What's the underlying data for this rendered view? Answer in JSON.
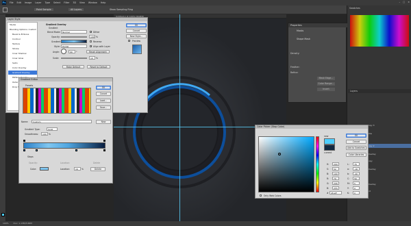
{
  "menubar": {
    "logo": "Ps",
    "items": [
      "File",
      "Edit",
      "Image",
      "Layer",
      "Type",
      "Select",
      "Filter",
      "3D",
      "View",
      "Window",
      "Help"
    ],
    "window_controls": [
      "–",
      "□",
      "×"
    ]
  },
  "options": {
    "show_sampling_ring": "Show Sampling Ring",
    "sample_size": "Point Sample",
    "sample": "All Layers"
  },
  "tabs": [
    "Untitled-1 @ 100% (RGB/8)"
  ],
  "status": {
    "zoom": "100%",
    "doc": "Doc: 1.13M/3.66M"
  },
  "layer_style": {
    "title": "Layer Style",
    "styles_header": "Styles",
    "items": [
      "Blending Options: Custom",
      "Bevel & Emboss",
      "Contour",
      "Texture",
      "Stroke",
      "Inner Shadow",
      "Inner Glow",
      "Satin",
      "Color Overlay",
      "Gradient Overlay",
      "Pattern Overlay",
      "Outer Glow",
      "Drop Shadow"
    ],
    "selected_index": 9,
    "section_title": "Gradient Overlay",
    "section_sub": "Gradient",
    "blend_mode_label": "Blend Mode:",
    "blend_mode": "Normal",
    "dither": "Dither",
    "opacity_label": "Opacity:",
    "opacity": "100",
    "pct": "%",
    "gradient_label": "Gradient:",
    "reverse": "Reverse",
    "style_label": "Style:",
    "style": "Radial",
    "align": "Align with Layer",
    "angle_label": "Angle:",
    "angle": "90",
    "deg": "°",
    "reset_alignment": "Reset Alignment",
    "scale_label": "Scale:",
    "scale": "10",
    "make_default": "Make Default",
    "reset_default": "Reset to Default",
    "ok": "OK",
    "cancel": "Cancel",
    "new_style": "New Style...",
    "preview": "Preview"
  },
  "gradient_editor": {
    "title": "Gradient Editor",
    "presets": "Presets",
    "ok": "OK",
    "cancel": "Cancel",
    "load": "Load...",
    "save": "Save...",
    "name_label": "Name:",
    "name": "Custom",
    "new": "New",
    "type_label": "Gradient Type:",
    "type": "Solid",
    "smooth_label": "Smoothness:",
    "smooth": "100",
    "pct": "%",
    "stops_label": "Stops",
    "opacity_label": "Opacity:",
    "location_label": "Location:",
    "delete": "Delete",
    "color_label": "Color:",
    "location": "16",
    "loc_pct": "%",
    "colors": {
      "left": "#2a7fc8",
      "mid": "#7fc6f0",
      "right": "#0a1e40"
    }
  },
  "color_picker": {
    "title": "Color Picker (Stop Color)",
    "new_label": "new",
    "current_label": "current",
    "ok": "OK",
    "cancel": "Cancel",
    "add_swatches": "Add to Swatches",
    "color_libraries": "Color Libraries",
    "only_web": "Only Web Colors",
    "h": "H:",
    "h_val": "200",
    "s": "S:",
    "s_val": "52",
    "b": "B:",
    "b_val": "100",
    "r": "R:",
    "r_val": "79",
    "g": "G:",
    "g_val": "206",
    "bb": "B:",
    "bb_val": "255",
    "l": "L:",
    "l_val": "76",
    "a": "a:",
    "a_val": "-18",
    "b3": "b:",
    "b3_val": "-40",
    "c": "C:",
    "c_val": "56",
    "m": "M:",
    "m_val": "5",
    "y": "Y:",
    "y_val": "0",
    "k": "K:",
    "k_val": "0",
    "hex_label": "#",
    "hex": "4fceff",
    "new_color": "#4fceff",
    "current_color": "#132840"
  },
  "properties": {
    "title": "Properties",
    "sub": "Masks",
    "shape_label": "Shape Mask",
    "density": "Density:",
    "feather": "Feather:",
    "refine": "Refine:",
    "mask_edge": "Mask Edge...",
    "color_range": "Color Range...",
    "invert": "Invert"
  },
  "panel_title": "Swatches",
  "layers": {
    "title": "Layers",
    "rows": [
      "Ellipse 1 copy 3",
      "Effects",
      "Drop Shadow",
      "Ellipse 1 copy 2",
      "Effects",
      "Gradient Overlay",
      "Ellipse 1 copy",
      "Effects",
      "Gradient Overlay",
      "Ellipse 1",
      "Effects",
      "Gradient Overlay",
      "Background"
    ],
    "selected_index": 3
  }
}
